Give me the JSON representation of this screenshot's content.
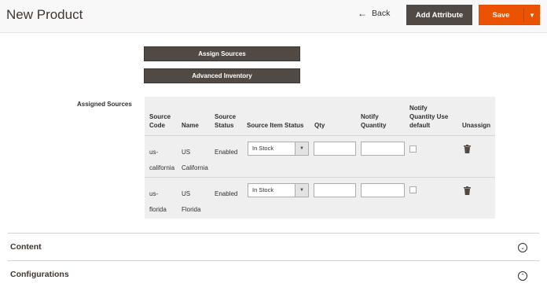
{
  "header": {
    "title": "New Product",
    "back_label": "Back",
    "add_attribute_label": "Add Attribute",
    "save_label": "Save"
  },
  "actions": {
    "assign_sources_label": "Assign Sources",
    "advanced_inventory_label": "Advanced Inventory"
  },
  "assigned_sources": {
    "label": "Assigned Sources",
    "columns": {
      "source_code": [
        "Source",
        "Code"
      ],
      "name": "Name",
      "source_status": [
        "Source",
        "Status"
      ],
      "source_item_status": "Source Item Status",
      "qty": "Qty",
      "notify_quantity": [
        "Notify",
        "Quantity"
      ],
      "notify_use_default": [
        "Notify",
        "Quantity Use",
        "default"
      ],
      "unassign": "Unassign"
    },
    "rows": [
      {
        "source_code": [
          "us-",
          "california"
        ],
        "name": [
          "US",
          "California"
        ],
        "status": "Enabled",
        "item_status": "In Stock",
        "qty": "",
        "notify_quantity": "",
        "use_default_checked": false
      },
      {
        "source_code": [
          "us-",
          "florida"
        ],
        "name": [
          "US",
          "Florida"
        ],
        "status": "Enabled",
        "item_status": "In Stock",
        "qty": "",
        "notify_quantity": "",
        "use_default_checked": false
      }
    ]
  },
  "sections": [
    {
      "title": "Content",
      "toggle_icon": "chevron-down-circle"
    },
    {
      "title": "Configurations",
      "toggle_icon": "chevron-up-circle"
    }
  ],
  "colors": {
    "dark_button": "#514943",
    "save_button": "#eb5202",
    "grid_background": "#efefef"
  }
}
